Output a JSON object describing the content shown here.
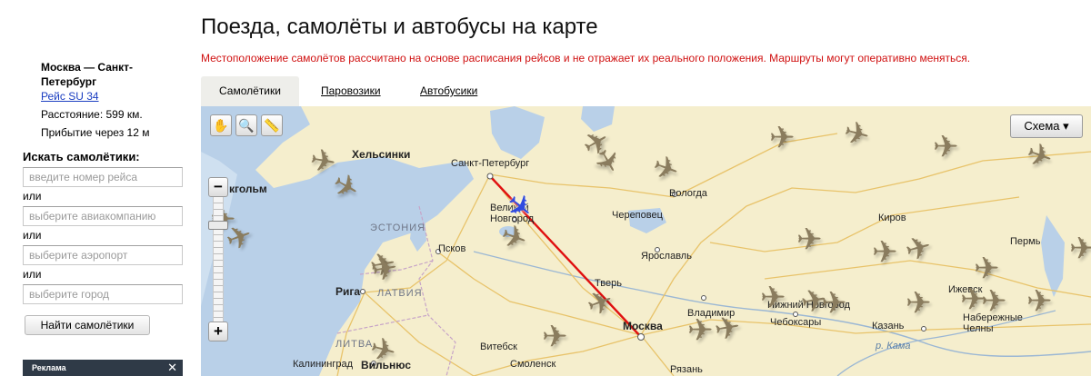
{
  "sidebar": {
    "flight": {
      "route": "Москва — Санкт-Петербург",
      "link": "Рейс SU 34",
      "distance": "Расстояние: 599 км.",
      "arrival": "Прибытие через 12 м"
    },
    "search": {
      "title": "Искать самолётики:",
      "flight_placeholder": "введите номер рейса",
      "or1": "или",
      "airline_placeholder": "выберите авиакомпанию",
      "or2": "или",
      "airport_placeholder": "выберите аэропорт",
      "or3": "или",
      "city_placeholder": "выберите город",
      "button": "Найти самолётики"
    },
    "ad": {
      "label": "Реклама",
      "close": "✕"
    }
  },
  "header": {
    "title": "Поезда, самолёты и автобусы на карте",
    "notice": "Местоположение самолётов рассчитано на основе расписания рейсов и не отражает их реального положения. Маршруты могут оперативно меняться."
  },
  "tabs": [
    {
      "label": "Самолётики",
      "active": true
    },
    {
      "label": "Паровозики",
      "active": false
    },
    {
      "label": "Автобусики",
      "active": false
    }
  ],
  "map": {
    "scheme_label": "Схема ▾",
    "zoom_in": "+",
    "zoom_out": "−",
    "tools": {
      "hand": "✋",
      "magnifier": "🔍",
      "ruler": "📏"
    },
    "plane_glyph": "✈",
    "cities": {
      "helsinki": "Хельсинки",
      "stockholm": "кгольм",
      "spb": "Санкт-Петербург",
      "vologda": "Вологда",
      "novgorod": "Великий Новгород",
      "cherepovets": "Череповец",
      "kirov": "Киров",
      "perm": "Пермь",
      "pskov": "Псков",
      "yaroslavl": "Ярославль",
      "riga": "Рига",
      "tver": "Тверь",
      "nnovgorod": "Нижний Новгород",
      "izhevsk": "Ижевск",
      "vladimir": "Владимир",
      "naberezhnye": "Набережные Челны",
      "cheboksary": "Чебоксары",
      "kazan": "Казань",
      "moscow": "Москва",
      "vitebsk": "Витебск",
      "kaliningrad": "Калининград",
      "vilnius": "Вильнюс",
      "smolensk": "Смоленск",
      "ryazan": "Рязань",
      "kama": "р. Кама"
    },
    "regions": {
      "estonia": "ЭСТОНИЯ",
      "latvia": "ЛАТВИЯ",
      "lithuania": "ЛИТВА"
    },
    "colors": {
      "land": "#f5eecd",
      "water": "#b9d0e8",
      "route": "#e01010",
      "plane": "#8a7c5e",
      "active_plane": "#2f4ae0"
    }
  }
}
